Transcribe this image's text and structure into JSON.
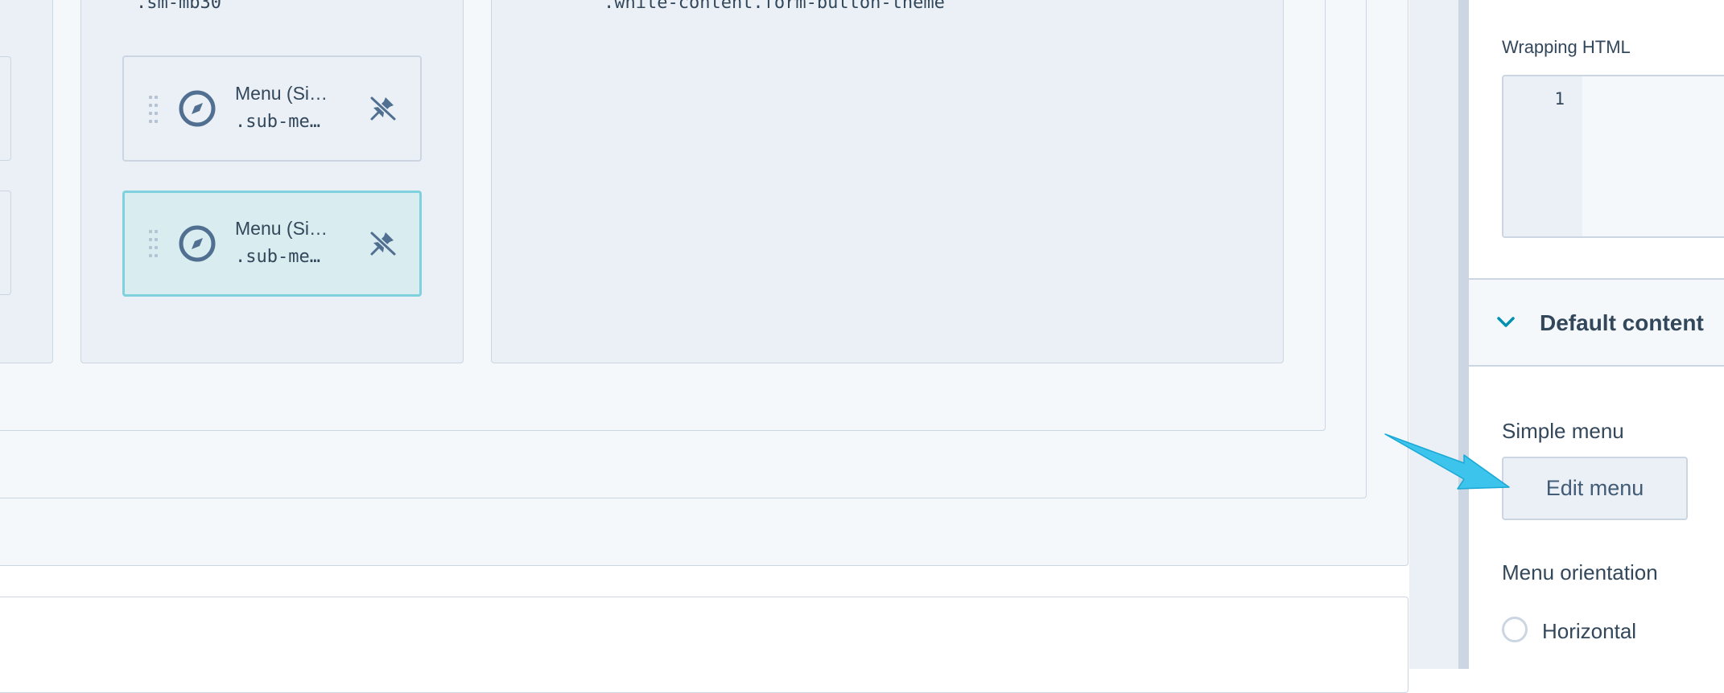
{
  "canvas": {
    "column_b_class": ".sm-mb30",
    "column_c_class": ".white-content.form-button-theme",
    "modules": [
      {
        "title": "Menu (Si…",
        "class_name": ".sub-me…",
        "selected": false,
        "icon": "compass-icon",
        "pin_icon": "unpin-icon"
      },
      {
        "title": "Menu (Si…",
        "class_name": ".sub-me…",
        "selected": true,
        "icon": "compass-icon",
        "pin_icon": "unpin-icon"
      }
    ]
  },
  "panel": {
    "wrapping_html_label": "Wrapping HTML",
    "code_line_number": "1",
    "section": {
      "title": "Default content",
      "icon": "chevron-down-icon"
    },
    "simple_menu_label": "Simple menu",
    "edit_menu_button": "Edit menu",
    "orientation_label": "Menu orientation",
    "orientation_options": [
      "Horizontal"
    ]
  },
  "annotation": {
    "icon": "pointer-arrow-icon",
    "color": "#3cc4ec"
  },
  "colors": {
    "border": "#cbd6e2",
    "text": "#33475b",
    "accent": "#0091ae",
    "selected_border": "#7fd1de",
    "selected_bg": "#d9ecef"
  }
}
